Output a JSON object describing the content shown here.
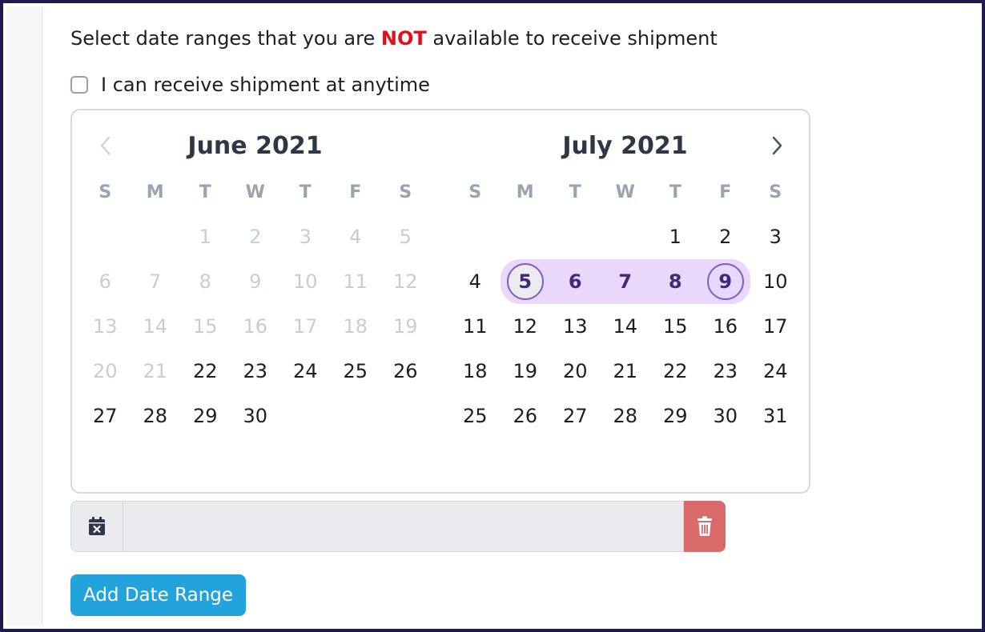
{
  "prompt": {
    "before": "Select date ranges that you are ",
    "emphasis": "NOT",
    "after": " available to receive shipment"
  },
  "anytime_checkbox": {
    "label": "I can receive shipment at anytime",
    "checked": false
  },
  "calendar": {
    "prev_icon": "chevron-left-icon",
    "next_icon": "chevron-right-icon",
    "weekdays": [
      "S",
      "M",
      "T",
      "W",
      "T",
      "F",
      "S"
    ],
    "months": [
      {
        "title": "June 2021",
        "offset": 2,
        "days": 30,
        "disabled_through": 21,
        "range": null
      },
      {
        "title": "July 2021",
        "offset": 4,
        "days": 31,
        "disabled_through": 0,
        "range": [
          5,
          9
        ]
      }
    ],
    "range_color": "#e9d8fb",
    "range_text_color": "#3d2a78"
  },
  "date_range_field": {
    "value": "",
    "placeholder": "",
    "icon": "calendar-x-icon",
    "delete_icon": "trash-icon"
  },
  "buttons": {
    "add_date_range": "Add Date Range"
  },
  "colors": {
    "accent": "#22a3dc",
    "danger": "#db6a6a",
    "emphasis": "#e3101a",
    "frame": "#1f1a4d"
  }
}
